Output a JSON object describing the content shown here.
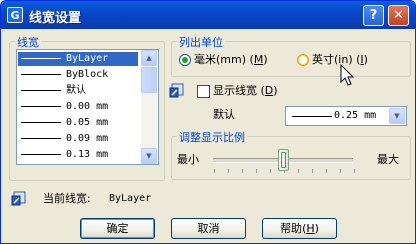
{
  "window": {
    "title": "线宽设置",
    "help_btn": "?",
    "close_btn": "✕"
  },
  "lineweight_group": {
    "label": "线宽",
    "items": [
      {
        "label": "ByLayer",
        "selected": true
      },
      {
        "label": "ByBlock",
        "selected": false
      },
      {
        "label": "默认",
        "selected": false
      },
      {
        "label": "0.00 mm",
        "selected": false
      },
      {
        "label": "0.05 mm",
        "selected": false
      },
      {
        "label": "0.09 mm",
        "selected": false
      },
      {
        "label": "0.13 mm",
        "selected": false
      }
    ]
  },
  "units_group": {
    "label": "列出单位",
    "mm": {
      "text": "毫米(mm)",
      "hotkey": "M",
      "checked": true
    },
    "inch": {
      "text": "英寸(in)",
      "hotkey": "I",
      "checked": false
    }
  },
  "display": {
    "text": "显示线宽",
    "hotkey": "D",
    "checked": false
  },
  "default": {
    "label": "默认",
    "value": "0.25 mm"
  },
  "scale_group": {
    "label": "调整显示比例",
    "min_label": "最小",
    "max_label": "最大",
    "position_percent": 50
  },
  "current": {
    "label": "当前线宽:",
    "value": "ByLayer"
  },
  "buttons": {
    "ok": "确定",
    "cancel": "取消",
    "help": "帮助",
    "help_hotkey": "H"
  }
}
